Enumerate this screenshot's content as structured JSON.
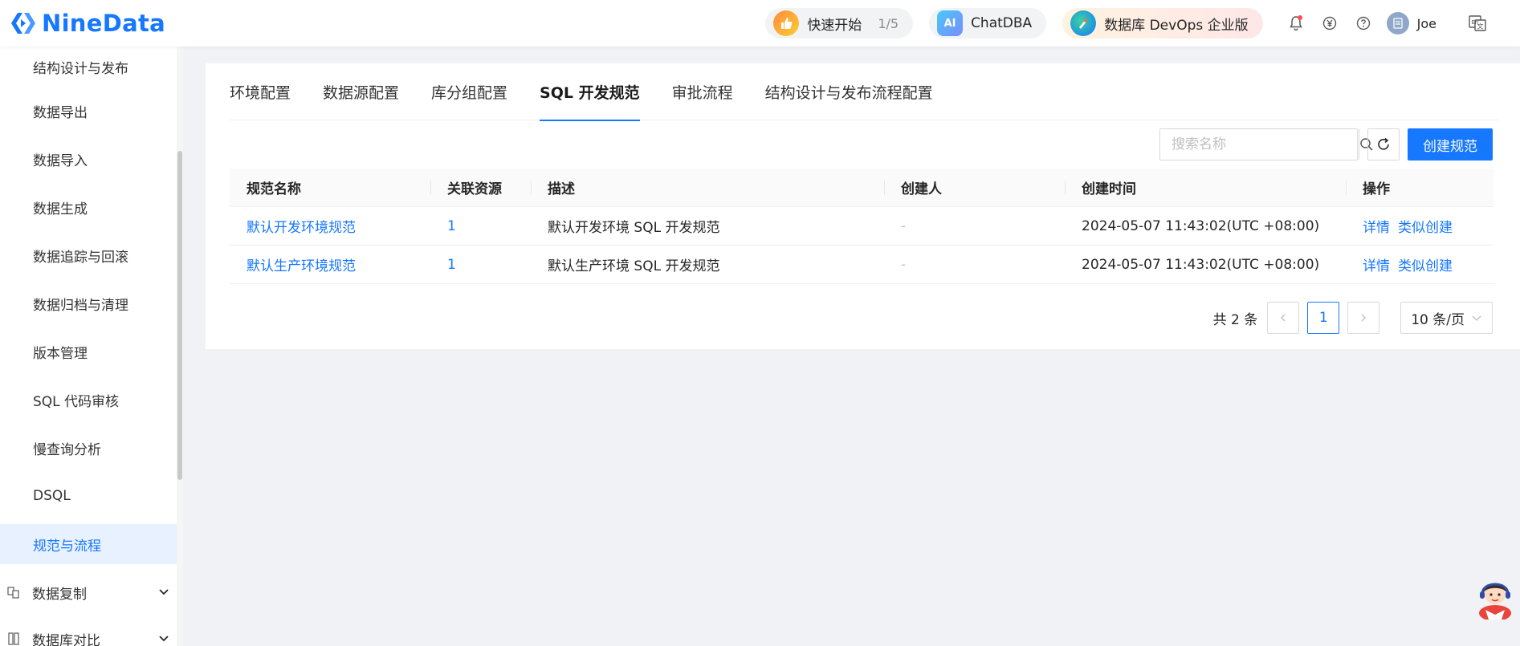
{
  "header": {
    "logo_text": "NineData",
    "quick_start": {
      "label": "快速开始",
      "progress": "1/5"
    },
    "chatdba": {
      "label": "ChatDBA"
    },
    "devops": {
      "label": "数据库 DevOps 企业版"
    },
    "user": {
      "name": "Joe"
    },
    "icons": [
      "bell-icon",
      "yen-icon",
      "help-icon",
      "avatar",
      "language-switch-icon"
    ],
    "notification_dot_color": "#ff4d4f"
  },
  "sidebar": {
    "items": [
      {
        "label": "结构设计与发布"
      },
      {
        "label": "数据导出"
      },
      {
        "label": "数据导入"
      },
      {
        "label": "数据生成"
      },
      {
        "label": "数据追踪与回滚"
      },
      {
        "label": "数据归档与清理"
      },
      {
        "label": "版本管理"
      },
      {
        "label": "SQL 代码审核"
      },
      {
        "label": "慢查询分析"
      },
      {
        "label": "DSQL"
      },
      {
        "label": "规范与流程",
        "active": true
      }
    ],
    "groups": [
      {
        "label": "数据复制",
        "icon": "replication-icon"
      },
      {
        "label": "数据库对比",
        "icon": "compare-icon"
      }
    ]
  },
  "tabs": [
    {
      "label": "环境配置"
    },
    {
      "label": "数据源配置"
    },
    {
      "label": "库分组配置"
    },
    {
      "label": "SQL 开发规范",
      "active": true
    },
    {
      "label": "审批流程"
    },
    {
      "label": "结构设计与发布流程配置"
    }
  ],
  "toolbar": {
    "search_placeholder": "搜索名称",
    "create_label": "创建规范"
  },
  "table": {
    "columns": [
      "规范名称",
      "关联资源",
      "描述",
      "创建人",
      "创建时间",
      "操作"
    ],
    "rows": [
      {
        "name": "默认开发环境规范",
        "resources": "1",
        "description": "默认开发环境 SQL 开发规范",
        "creator": "-",
        "created_at": "2024-05-07 11:43:02(UTC +08:00)",
        "action_detail": "详情",
        "action_clone": "类似创建"
      },
      {
        "name": "默认生产环境规范",
        "resources": "1",
        "description": "默认生产环境 SQL 开发规范",
        "creator": "-",
        "created_at": "2024-05-07 11:43:02(UTC +08:00)",
        "action_detail": "详情",
        "action_clone": "类似创建"
      }
    ]
  },
  "pagination": {
    "total_text": "共 2 条",
    "current_page": "1",
    "page_size": "10 条/页"
  },
  "colors": {
    "primary": "#1677ff",
    "background": "#f0f2f5"
  }
}
